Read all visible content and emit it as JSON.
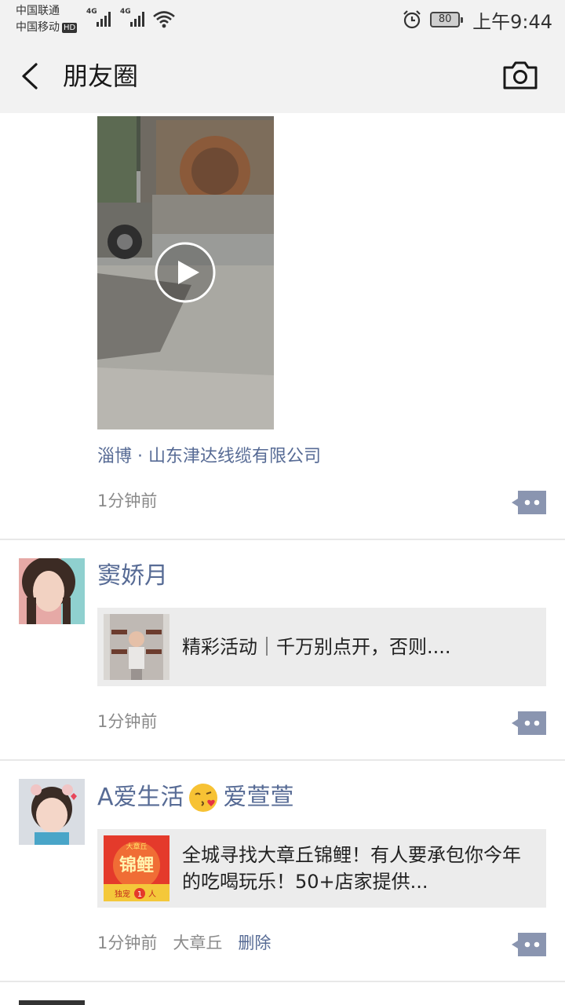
{
  "status_bar": {
    "carrier_1": "中国联通",
    "carrier_2": "中国移动",
    "hd": "HD",
    "network_1": "4G",
    "network_2": "4G",
    "battery": "80",
    "time": "上午9:44"
  },
  "nav": {
    "back_icon": "chevron-left-icon",
    "title": "朋友圈",
    "camera_icon": "camera-icon"
  },
  "posts": [
    {
      "media": "video",
      "location": "淄博 · 山东津达线缆有限公司",
      "time": "1分钟前"
    },
    {
      "author": "窦娇月",
      "share_text": "精彩活动｜千万别点开，否则....",
      "time": "1分钟前"
    },
    {
      "author_prefix": "A爱生活",
      "author_emoji": "kissing-face-emoji",
      "author_suffix": "爱萱萱",
      "share_text": "全城寻找大章丘锦鲤！有人要承包你今年的吃喝玩乐！50+店家提供...",
      "share_thumb_text": {
        "top": "大章丘",
        "main": "锦鲤",
        "bottom_1": "独宠",
        "bottom_num": "1",
        "bottom_2": "人"
      },
      "time": "1分钟前",
      "location": "大章丘",
      "delete_label": "删除"
    }
  ],
  "colors": {
    "link_blue": "#576b95",
    "bar_bg": "#f2f2f2",
    "share_bg": "#ececec"
  }
}
